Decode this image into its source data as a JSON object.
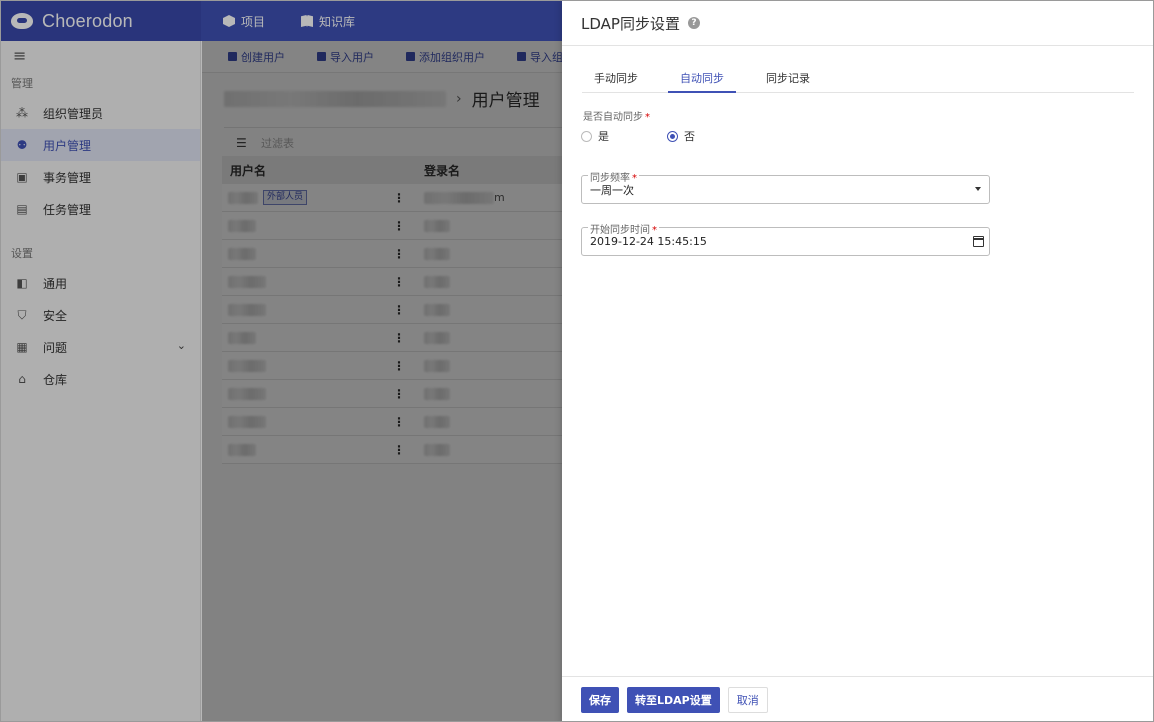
{
  "app": {
    "brand": "Choerodon",
    "accent": "#3f51b5"
  },
  "topnav": [
    {
      "label": "项目",
      "icon": "cube-icon"
    },
    {
      "label": "知识库",
      "icon": "book-icon"
    }
  ],
  "sidebar": {
    "section_manage": "管理",
    "section_settings": "设置",
    "manage_items": [
      {
        "label": "组织管理员",
        "icon": "users-icon",
        "active": false
      },
      {
        "label": "用户管理",
        "icon": "user-manage-icon",
        "active": true
      },
      {
        "label": "事务管理",
        "icon": "task-icon",
        "active": false
      },
      {
        "label": "任务管理",
        "icon": "job-icon",
        "active": false
      }
    ],
    "settings_items": [
      {
        "label": "通用",
        "icon": "general-icon"
      },
      {
        "label": "安全",
        "icon": "shield-icon"
      },
      {
        "label": "问题",
        "icon": "clipboard-icon"
      },
      {
        "label": "仓库",
        "icon": "bank-icon"
      }
    ]
  },
  "toolbar": {
    "create_user": "创建用户",
    "import_user": "导入用户",
    "add_org_user": "添加组织用户",
    "import_org": "导入组织"
  },
  "breadcrumb": {
    "sep": "›",
    "title": "用户管理"
  },
  "filter": {
    "placeholder": "过滤表"
  },
  "table": {
    "col_username": "用户名",
    "col_loginname": "登录名",
    "row0_tag": "外部人员",
    "row0_login_suffix": "m",
    "dots": "⋮"
  },
  "drawer": {
    "title": "LDAP同步设置",
    "help": "?",
    "tabs": [
      "手动同步",
      "自动同步",
      "同步记录"
    ],
    "active_tab": 1,
    "auto_sync_label": "是否自动同步",
    "required_mark": "*",
    "radio_yes": "是",
    "radio_no": "否",
    "selected": "否",
    "freq_label": "同步频率",
    "freq_value": "一周一次",
    "start_label": "开始同步时间",
    "start_value": "2019-12-24 15:45:15",
    "save_label": "保存",
    "goto_ldap_label": "转至LDAP设置",
    "cancel_label": "取消"
  }
}
